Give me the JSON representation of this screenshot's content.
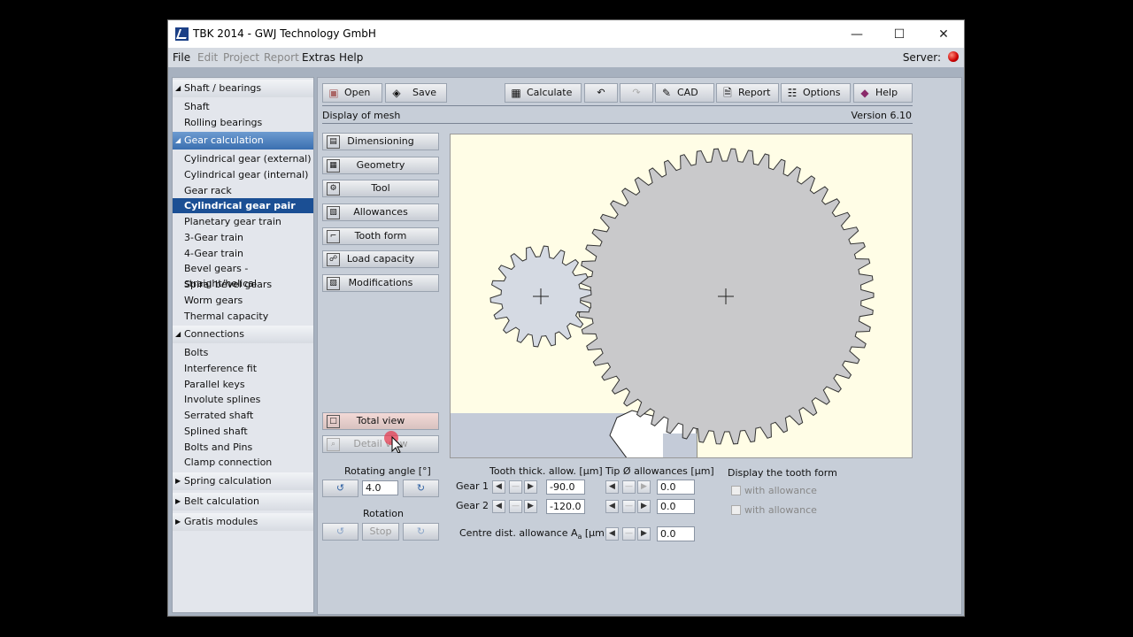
{
  "window": {
    "title": "TBK 2014 - GWJ Technology GmbH",
    "minimize": "—",
    "maximize": "☐",
    "close": "✕"
  },
  "menu": {
    "file": "File",
    "edit": "Edit",
    "project": "Project",
    "report": "Report",
    "extras": "Extras",
    "help": "Help",
    "server": "Server:"
  },
  "sidebar": {
    "sections": [
      {
        "label": "Shaft / bearings",
        "items": [
          "Shaft",
          "Rolling bearings"
        ]
      },
      {
        "label": "Gear calculation",
        "items": [
          "Cylindrical gear (external)",
          "Cylindrical gear (internal)",
          "Gear rack",
          "Cylindrical gear pair",
          "Planetary gear train",
          "3-Gear train",
          "4-Gear train",
          "Bevel gears - straight/helical",
          "Spiral bevel gears",
          "Worm gears",
          "Thermal capacity"
        ]
      },
      {
        "label": "Connections",
        "items": [
          "Bolts",
          "Interference fit",
          "Parallel keys",
          "Involute splines",
          "Serrated shaft",
          "Splined shaft",
          "Bolts and Pins",
          "Clamp connection"
        ]
      },
      {
        "label": "Spring calculation",
        "items": []
      },
      {
        "label": "Belt calculation",
        "items": []
      },
      {
        "label": "Gratis modules",
        "items": []
      }
    ]
  },
  "toolbar": {
    "open": "Open",
    "save": "Save",
    "calculate": "Calculate",
    "undo": "↶",
    "redo": "↷",
    "cad": "CAD",
    "report": "Report",
    "options": "Options",
    "help": "Help"
  },
  "header": {
    "display": "Display of mesh",
    "version": "Version 6.10"
  },
  "left_buttons": [
    "Dimensioning",
    "Geometry",
    "Tool",
    "Allowances",
    "Tooth form",
    "Load capacity",
    "Modifications"
  ],
  "view_buttons": {
    "total": "Total view",
    "detail": "Detail view"
  },
  "rotation": {
    "angle_label": "Rotating angle [°]",
    "angle_value": "4.0",
    "rotation_label": "Rotation",
    "stop": "Stop"
  },
  "allowances": {
    "tooth_thick_label": "Tooth thick. allow. [µm]",
    "tip_label": "Tip Ø allowances [µm]",
    "gear1": "Gear 1",
    "gear2": "Gear 2",
    "gear1_thick": "-90.0",
    "gear2_thick": "-120.0",
    "gear1_tip": "0.0",
    "gear2_tip": "0.0",
    "centre_label": "Centre dist. allowance A",
    "centre_sub": "a",
    "centre_unit": " [µm]",
    "centre_value": "0.0"
  },
  "tooth_form": {
    "label": "Display the tooth form",
    "opt1": "with allowance",
    "opt2": "with allowance"
  }
}
